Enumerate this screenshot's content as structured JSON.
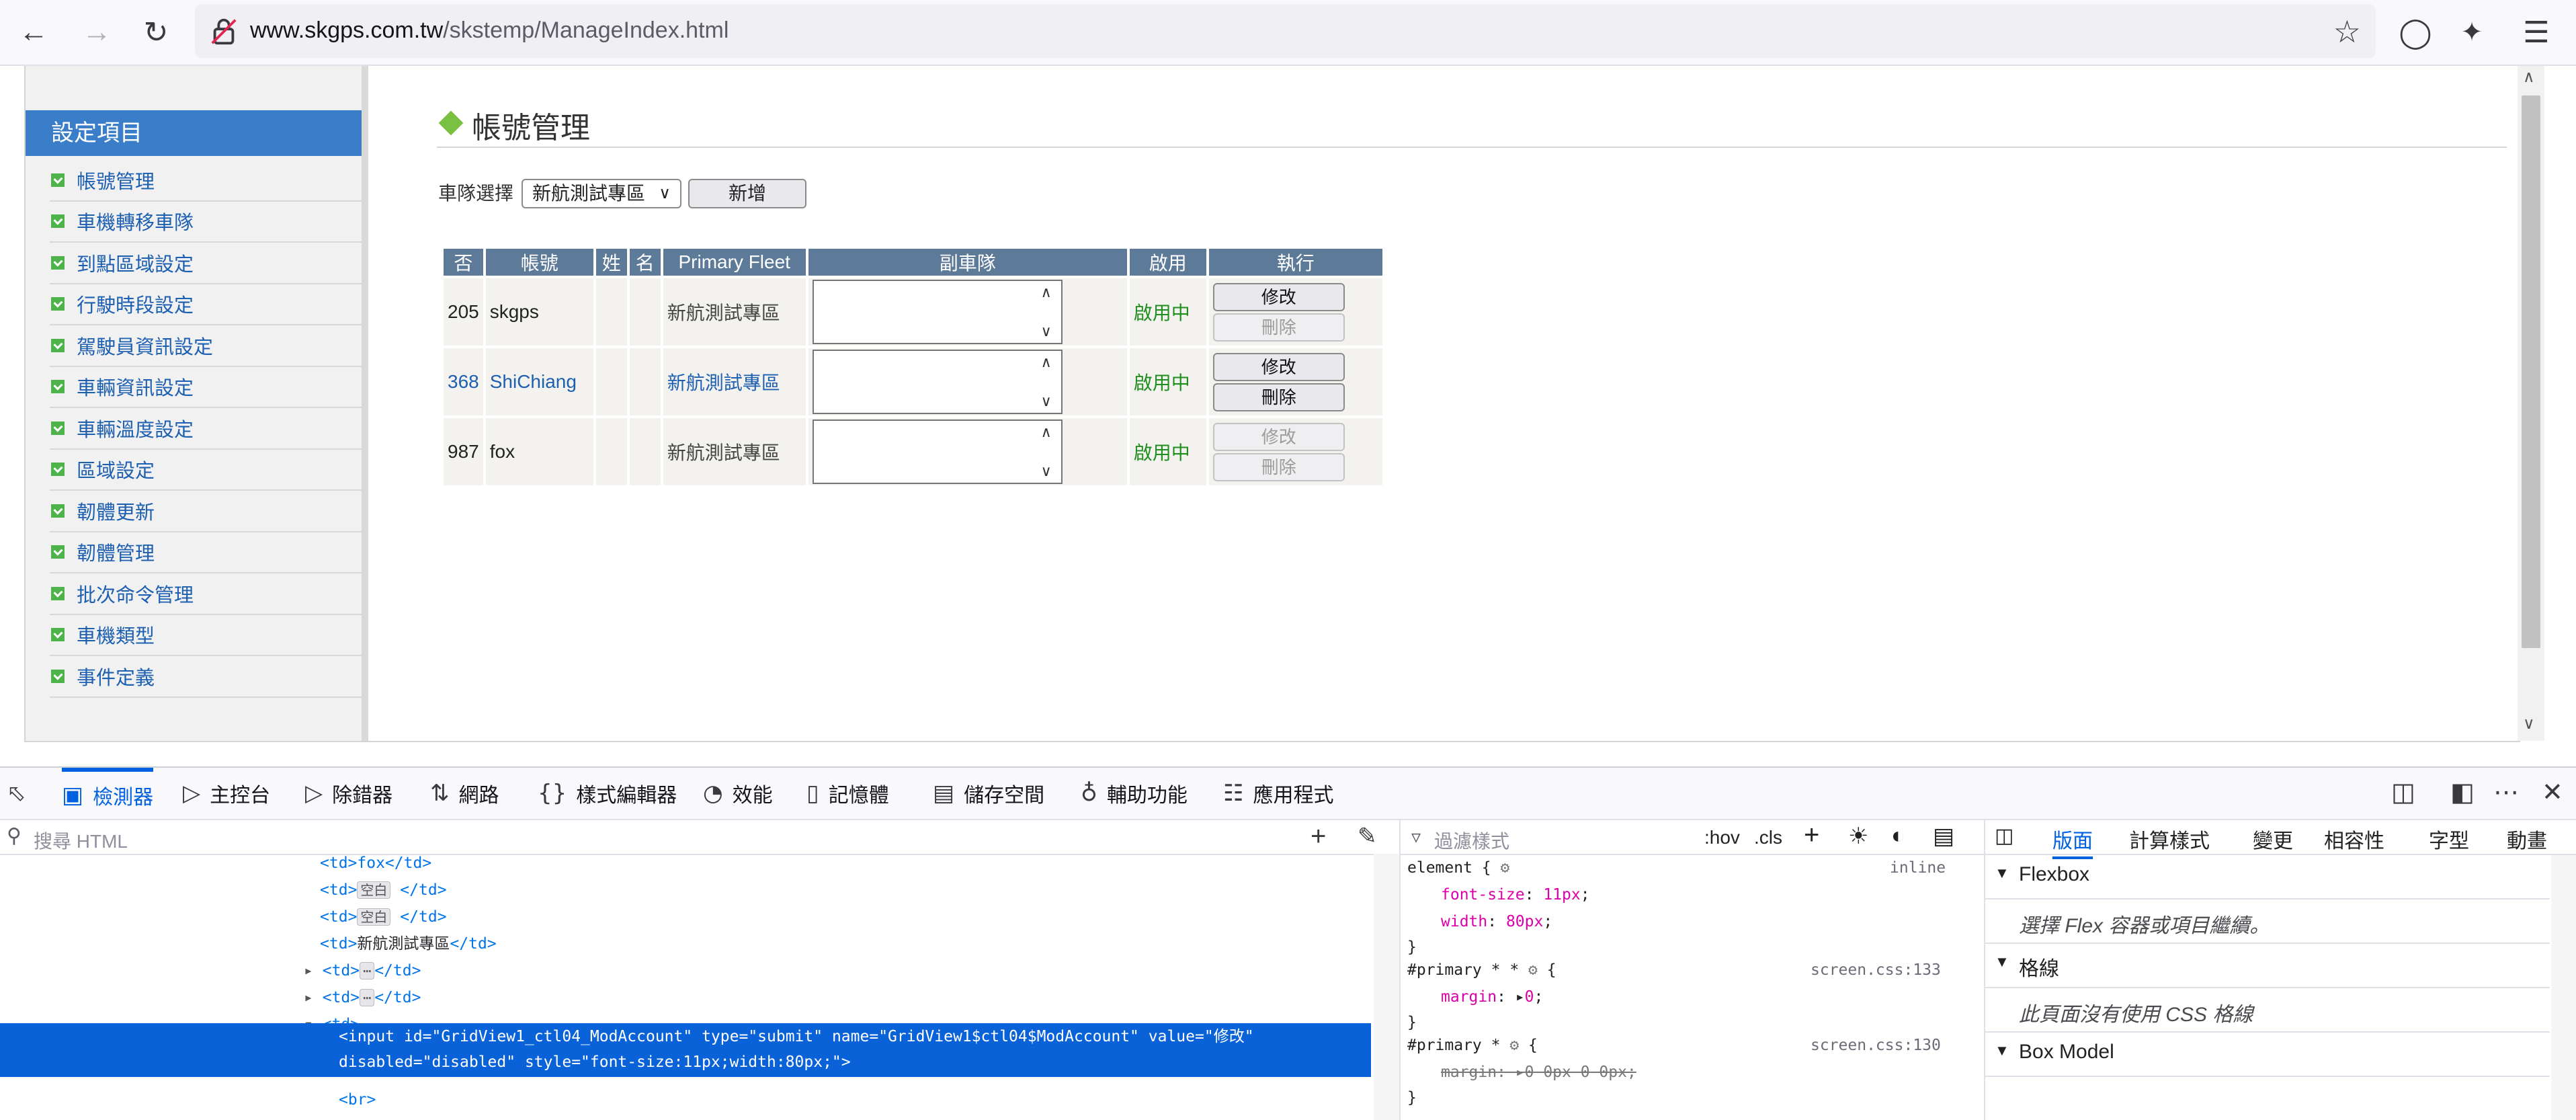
{
  "browser": {
    "url_host": "www.skgps.com.tw",
    "url_path": "/skstemp/ManageIndex.html"
  },
  "sidebar": {
    "heading": "設定項目",
    "items": [
      "帳號管理",
      "車機轉移車隊",
      "到點區域設定",
      "行駛時段設定",
      "駕駛員資訊設定",
      "車輛資訊設定",
      "車輛溫度設定",
      "區域設定",
      "韌體更新",
      "韌體管理",
      "批次命令管理",
      "車機類型",
      "事件定義"
    ]
  },
  "page": {
    "title": "帳號管理",
    "fleet_label": "車隊選擇",
    "fleet_selected": "新航測試專區",
    "add_button": "新增"
  },
  "grid": {
    "headers": [
      "否",
      "帳號",
      "姓",
      "名",
      "Primary Fleet",
      "副車隊",
      "啟用",
      "執行"
    ],
    "rows": [
      {
        "id": "205",
        "account": "skgps",
        "primary_fleet": "新航測試專區",
        "status": "啟用中",
        "edit": "修改",
        "delete": "刪除",
        "edit_enabled": true,
        "delete_enabled": false
      },
      {
        "id": "368",
        "account": "ShiChiang",
        "primary_fleet": "新航測試專區",
        "status": "啟用中",
        "edit": "修改",
        "delete": "刪除",
        "edit_enabled": true,
        "delete_enabled": true
      },
      {
        "id": "987",
        "account": "fox",
        "primary_fleet": "新航測試專區",
        "status": "啟用中",
        "edit": "修改",
        "delete": "刪除",
        "edit_enabled": false,
        "delete_enabled": false
      }
    ]
  },
  "devtools": {
    "tabs": [
      {
        "icon": "inspector-icon",
        "label": "檢測器"
      },
      {
        "icon": "console-icon",
        "label": "主控台"
      },
      {
        "icon": "debugger-icon",
        "label": "除錯器"
      },
      {
        "icon": "network-icon",
        "label": "網路"
      },
      {
        "icon": "style-editor-icon",
        "label": "樣式編輯器"
      },
      {
        "icon": "performance-icon",
        "label": "效能"
      },
      {
        "icon": "memory-icon",
        "label": "記憶體"
      },
      {
        "icon": "storage-icon",
        "label": "儲存空間"
      },
      {
        "icon": "accessibility-icon",
        "label": "輔助功能"
      },
      {
        "icon": "application-icon",
        "label": "應用程式"
      }
    ],
    "search_placeholder": "搜尋 HTML",
    "markup_lines": {
      "l0": "<td>fox</td>",
      "td": "td",
      "blank": "空白",
      "fleet": "新航測試專區",
      "input_line1_a": "<input ",
      "id_attr": "id=",
      "id_val": "\"GridView1_ctl04_ModAccount\"",
      "type_attr": " type=",
      "type_val": "\"submit\"",
      "name_attr": " name=",
      "name_val": "\"GridView1$ctl04$ModAccount\"",
      "value_attr": " value=",
      "value_val": "\"修改\"",
      "disabled_attr": "disabled=",
      "disabled_val": "\"disabled\"",
      "style_attr": " style=",
      "style_val": "\"font-size:11px;width:80px;\"",
      "close": ">",
      "br": "<br>"
    },
    "rules": {
      "filter_placeholder": "過濾樣式",
      "hov": ":hov",
      "cls": ".cls",
      "r1_selector": "element {",
      "r1_source": "inline",
      "r1_p1": "font-size",
      "r1_v1": "11px",
      "r1_p2": "width",
      "r1_v2": "80px",
      "r2_selector": "#primary * * ",
      "r2_source": "screen.css:133",
      "r2_p1": "margin",
      "r2_v1": "0",
      "r3_selector": "#primary * ",
      "r3_source": "screen.css:130",
      "r3_p1": "margin",
      "r3_v1": "0 0px 0 0px",
      "brace_close": "}",
      "brace_open": "{"
    },
    "layout": {
      "tabs": [
        "版面",
        "計算樣式",
        "變更",
        "相容性",
        "字型",
        "動畫"
      ],
      "flexbox_title": "Flexbox",
      "flexbox_hint": "選擇 Flex 容器或項目繼續。",
      "grid_title": "格線",
      "grid_hint": "此頁面沒有使用 CSS 格線",
      "boxmodel_title": "Box Model"
    }
  }
}
